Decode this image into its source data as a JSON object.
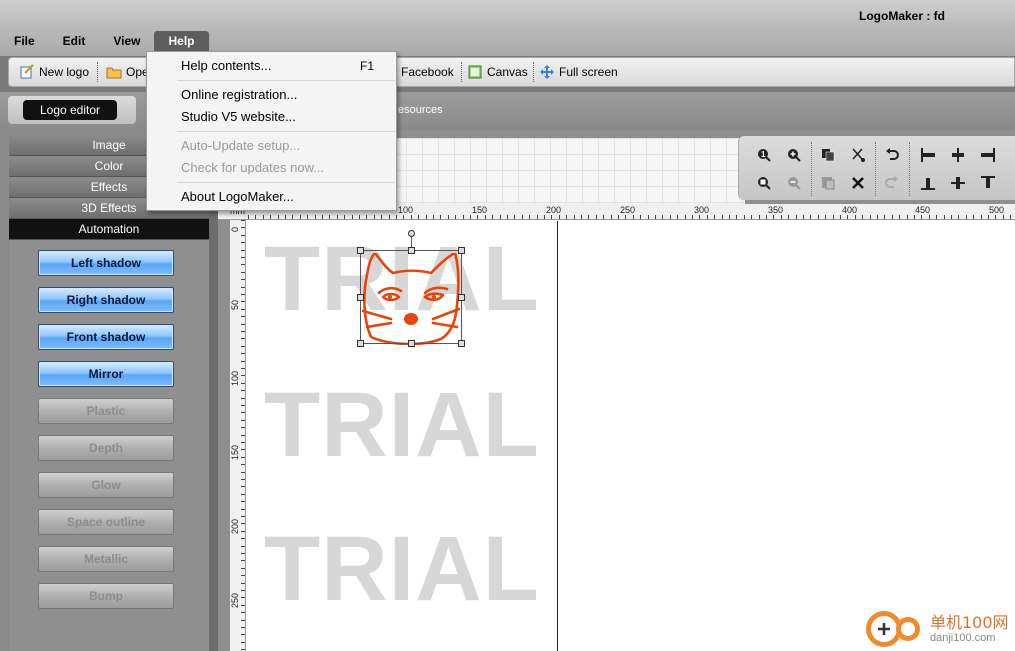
{
  "window": {
    "title": "LogoMaker : fd"
  },
  "menubar": {
    "items": [
      {
        "label": "File"
      },
      {
        "label": "Edit"
      },
      {
        "label": "View"
      },
      {
        "label": "Help",
        "active": true
      }
    ]
  },
  "toolbar": {
    "new_logo": "New logo",
    "open": "Ope",
    "facebook": "Facebook",
    "canvas": "Canvas",
    "full_screen": "Full screen"
  },
  "tabs": {
    "logo_editor": "Logo editor",
    "resources": "esources"
  },
  "sidebar": {
    "categories": [
      {
        "label": "Image"
      },
      {
        "label": "Color"
      },
      {
        "label": "Effects"
      },
      {
        "label": "3D Effects"
      },
      {
        "label": "Automation",
        "active": true
      }
    ],
    "buttons": [
      {
        "label": "Left shadow",
        "enabled": true
      },
      {
        "label": "Right shadow",
        "enabled": true
      },
      {
        "label": "Front shadow",
        "enabled": true
      },
      {
        "label": "Mirror",
        "enabled": true
      },
      {
        "label": "Plastic",
        "enabled": false
      },
      {
        "label": "Depth",
        "enabled": false
      },
      {
        "label": "Glow",
        "enabled": false
      },
      {
        "label": "Space outline",
        "enabled": false
      },
      {
        "label": "Metallic",
        "enabled": false
      },
      {
        "label": "Bump",
        "enabled": false
      }
    ]
  },
  "help_menu": {
    "help_contents": "Help contents...",
    "help_shortcut": "F1",
    "online_registration": "Online registration...",
    "studio_website": "Studio V5 website...",
    "auto_update": "Auto-Update setup...",
    "check_updates": "Check for updates now...",
    "about": "About LogoMaker..."
  },
  "ruler": {
    "unit": "mm",
    "h_labels": [
      "100",
      "150",
      "200",
      "250",
      "300",
      "350",
      "400",
      "450",
      "500"
    ],
    "v_labels": [
      "0",
      "50",
      "100",
      "150",
      "200",
      "250"
    ]
  },
  "canvas": {
    "watermark_text": "TRIAL",
    "logo_color": "#e8450a"
  },
  "site_watermark": {
    "name": "单机100网",
    "domain": "danji100.com"
  },
  "colors": {
    "enabled_button": "#5aa6f4",
    "active_tab": "#111111",
    "logo_stroke": "#e8450a"
  }
}
